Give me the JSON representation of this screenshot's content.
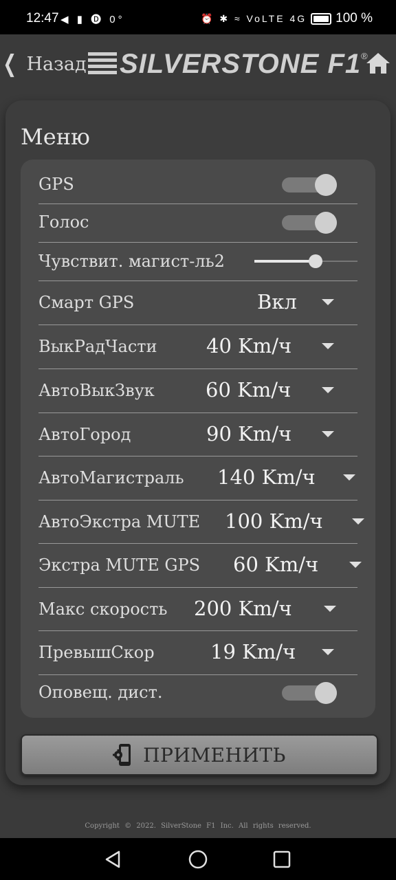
{
  "status_bar": {
    "time": "12:47",
    "left_icons": "◀ ▮ 🅓 0°",
    "right_icons": "⏰ ✱ ≈ VoLTE 4G",
    "battery": "100 %"
  },
  "header": {
    "back_label": "Назад",
    "logo_text": "SILVERSTONE F1",
    "logo_reg": "®",
    "home_icon": "home-icon"
  },
  "menu": {
    "title": "Меню",
    "rows": [
      {
        "label": "GPS",
        "control": "toggle",
        "on": true
      },
      {
        "label": "Голос",
        "control": "toggle",
        "on": true
      },
      {
        "label": "Чувствит. магист-ль2",
        "control": "slider",
        "level": 0.59
      },
      {
        "label": "Смарт GPS",
        "control": "select",
        "value": "Вкл"
      },
      {
        "label": "ВыкРадЧасти",
        "control": "select",
        "value": "40 Km/ч"
      },
      {
        "label": "АвтоВыкЗвук",
        "control": "select",
        "value": "60 Km/ч"
      },
      {
        "label": "АвтоГород",
        "control": "select",
        "value": "90 Km/ч"
      },
      {
        "label": "АвтоМагистраль",
        "control": "select",
        "value": "140 Km/ч"
      },
      {
        "label": "АвтоЭкстра MUTE",
        "control": "select",
        "value": "100 Km/ч"
      },
      {
        "label": "Экстра MUTE GPS",
        "control": "select",
        "value": "60 Km/ч"
      },
      {
        "label": "Макс скорость",
        "control": "select",
        "value": "200 Km/ч"
      },
      {
        "label": "ПревышСкор",
        "control": "select",
        "value": "19 Km/ч"
      },
      {
        "label": "Оповещ. дист.",
        "control": "toggle",
        "on": true
      }
    ]
  },
  "apply": {
    "label": "ПРИМЕНИТЬ",
    "icon": "phone-settings-icon"
  },
  "footer": {
    "copyright": "Copyright © 2022. SilverStone F1 Inc. All rights reserved."
  },
  "nav": {
    "back_icon": "triangle-back-icon",
    "home_icon": "circle-home-icon",
    "recents_icon": "square-recents-icon"
  },
  "colors": {
    "background": "#3a3a3a",
    "card": "#4a4a4a",
    "text": "#e8e8e8",
    "apply_button": "#8c8c8c"
  }
}
